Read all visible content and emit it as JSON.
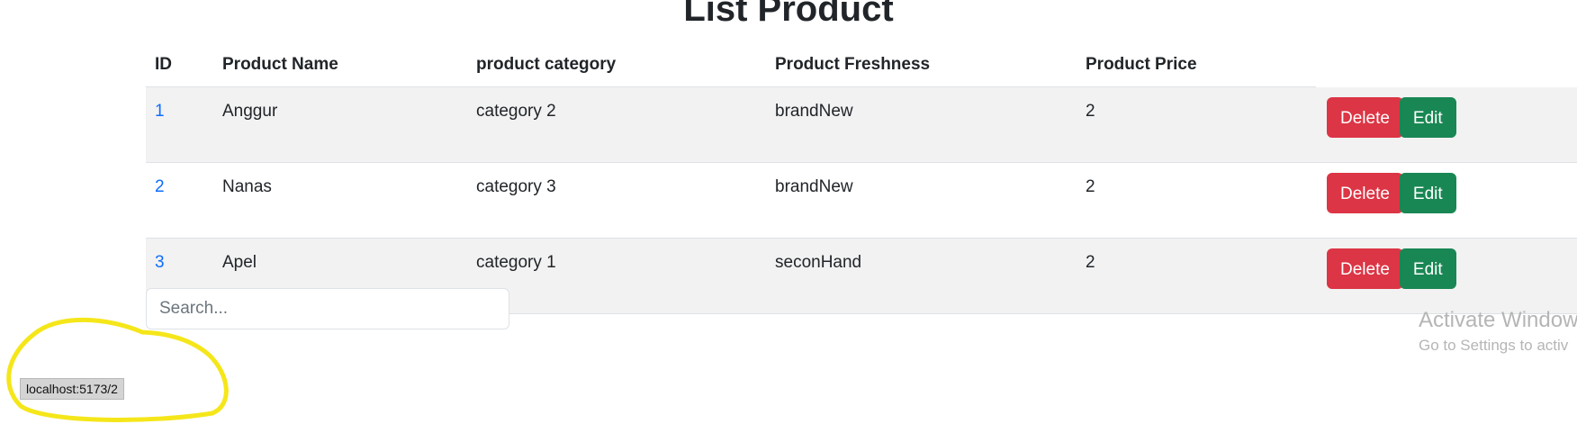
{
  "page": {
    "title": "List Product"
  },
  "table": {
    "columns": [
      "ID",
      "Product Name",
      "product category",
      "Product Freshness",
      "Product Price"
    ],
    "rows": [
      {
        "id": "1",
        "name": "Anggur",
        "category": "category 2",
        "freshness": "brandNew",
        "price": "2"
      },
      {
        "id": "2",
        "name": "Nanas",
        "category": "category 3",
        "freshness": "brandNew",
        "price": "2"
      },
      {
        "id": "3",
        "name": "Apel",
        "category": "category 1",
        "freshness": "seconHand",
        "price": "2"
      }
    ],
    "delete_label": "Delete",
    "edit_label": "Edit"
  },
  "search": {
    "placeholder": "Search...",
    "value": ""
  },
  "watermark": {
    "title": "Activate Window",
    "subtitle": "Go to Settings to activ"
  },
  "status_bar": {
    "url": "localhost:5173/2"
  },
  "colors": {
    "delete": "#dc3545",
    "edit": "#198754",
    "link": "#0d6efd",
    "stripe": "#f2f2f2",
    "annotation": "#f5e61a"
  }
}
